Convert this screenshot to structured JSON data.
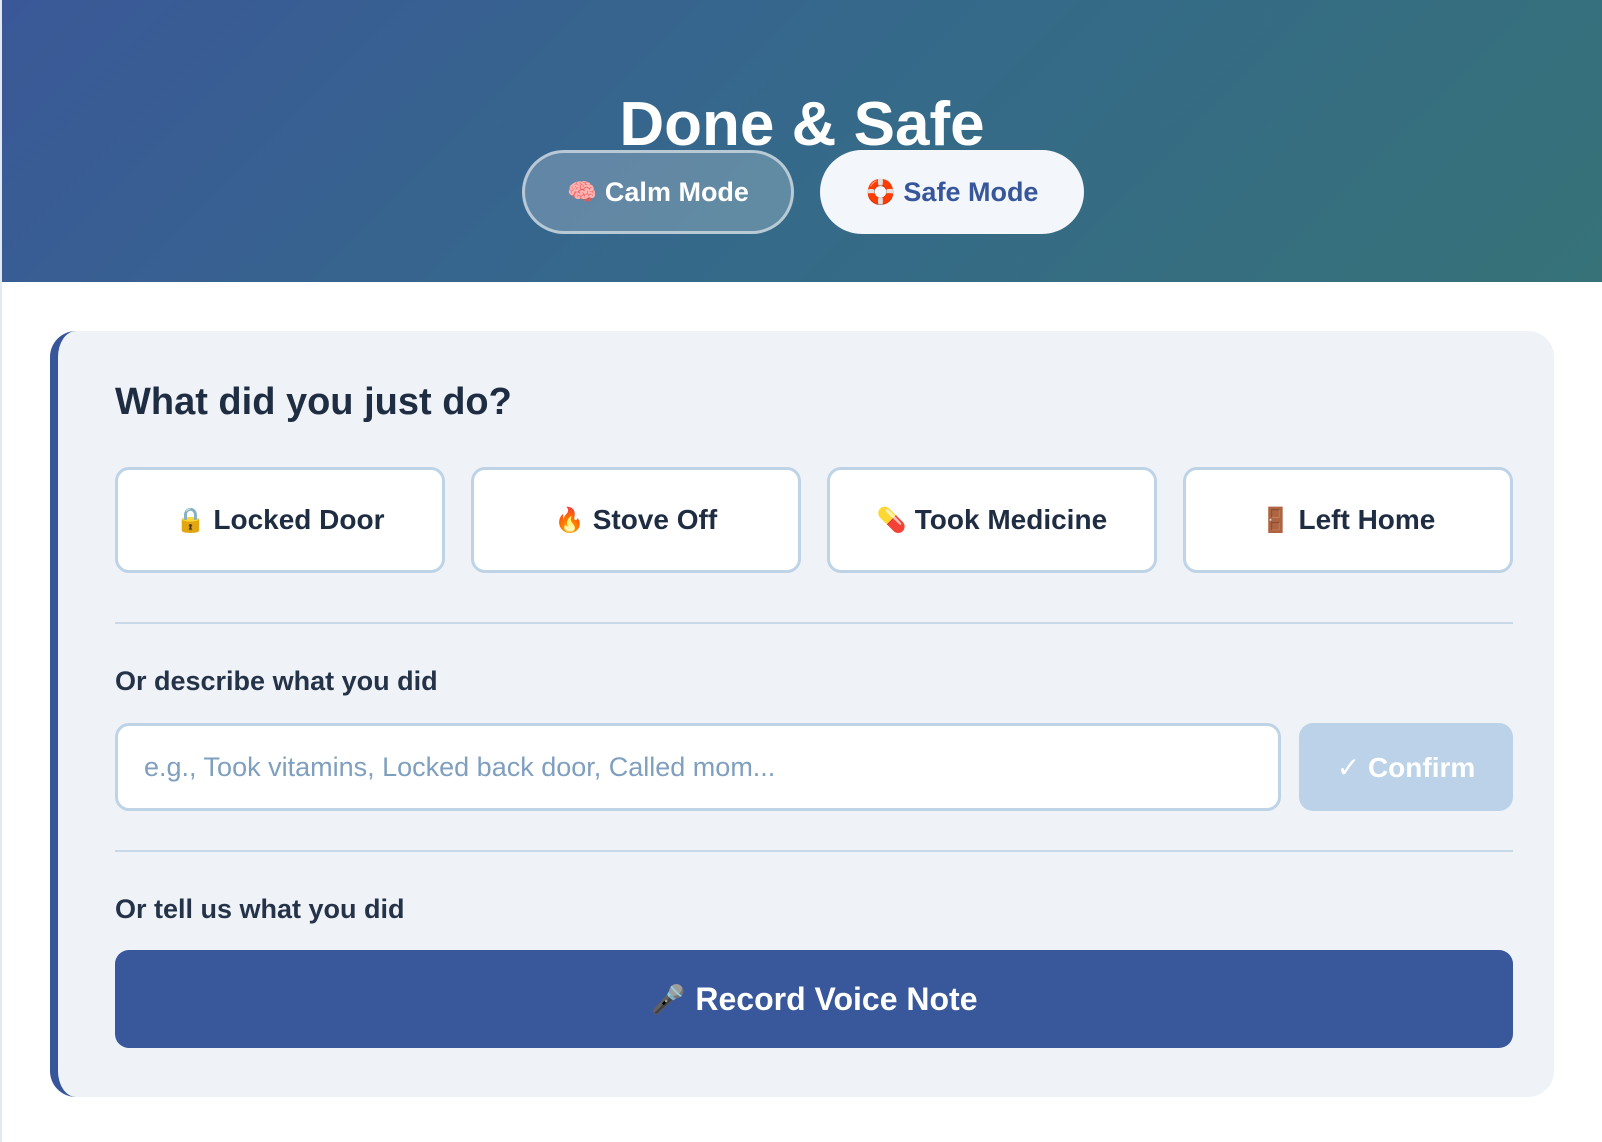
{
  "header": {
    "title": "Done & Safe",
    "modes": [
      {
        "icon": "🧠",
        "icon_name": "brain-icon",
        "label": "Calm Mode",
        "active": false
      },
      {
        "icon": "🛟",
        "icon_name": "lifebuoy-icon",
        "label": "Safe Mode",
        "active": true
      }
    ]
  },
  "main": {
    "question": "What did you just do?",
    "quick_actions": [
      {
        "icon": "🔒",
        "icon_name": "lock-icon",
        "label": "Locked Door"
      },
      {
        "icon": "🔥",
        "icon_name": "fire-icon",
        "label": "Stove Off"
      },
      {
        "icon": "💊",
        "icon_name": "pill-icon",
        "label": "Took Medicine"
      },
      {
        "icon": "🚪",
        "icon_name": "door-icon",
        "label": "Left Home"
      }
    ],
    "describe": {
      "label": "Or describe what you did",
      "placeholder": "e.g., Took vitamins, Locked back door, Called mom...",
      "value": "",
      "confirm_label": "✓ Confirm"
    },
    "voice": {
      "label": "Or tell us what you did",
      "icon": "🎤",
      "icon_name": "microphone-icon",
      "button_label": "Record Voice Note"
    }
  },
  "colors": {
    "header_gradient_start": "#3a5898",
    "header_gradient_end": "#367278",
    "accent": "#39579b",
    "card_background": "#eff3f8",
    "confirm_disabled": "#bcd2e8"
  }
}
